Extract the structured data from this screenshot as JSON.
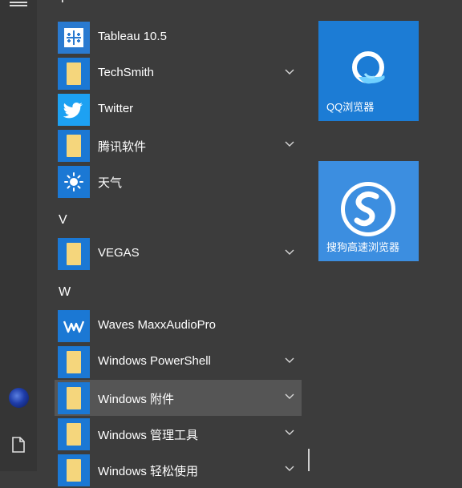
{
  "start_menu": {
    "sections": [
      {
        "letter": "T",
        "items": [
          {
            "label": "Tableau 10.5",
            "icon": "tableau-icon",
            "expandable": false
          },
          {
            "label": "TechSmith",
            "icon": "folder-icon",
            "expandable": true
          },
          {
            "label": "Twitter",
            "icon": "twitter-icon",
            "expandable": false
          },
          {
            "label": "腾讯软件",
            "icon": "folder-icon",
            "expandable": true
          },
          {
            "label": "天气",
            "icon": "weather-sun-icon",
            "expandable": false
          }
        ]
      },
      {
        "letter": "V",
        "items": [
          {
            "label": "VEGAS",
            "icon": "folder-icon",
            "expandable": true
          }
        ]
      },
      {
        "letter": "W",
        "items": [
          {
            "label": "Waves MaxxAudioPro",
            "icon": "waves-icon",
            "expandable": false
          },
          {
            "label": "Windows PowerShell",
            "icon": "folder-icon",
            "expandable": true
          },
          {
            "label": "Windows 附件",
            "icon": "folder-icon",
            "expandable": true,
            "selected": true
          },
          {
            "label": "Windows 管理工具",
            "icon": "folder-icon",
            "expandable": true
          },
          {
            "label": "Windows 轻松使用",
            "icon": "folder-icon",
            "expandable": true
          }
        ]
      }
    ]
  },
  "tiles": [
    {
      "label": "QQ浏览器",
      "icon": "qq-browser-icon"
    },
    {
      "label": "搜狗高速浏览器",
      "icon": "sogou-browser-icon"
    }
  ],
  "colors": {
    "background": "#3c3c3c",
    "tile_blue": "#1c7cd5",
    "selected_row": "#555555",
    "folder": "#f5d67c"
  }
}
